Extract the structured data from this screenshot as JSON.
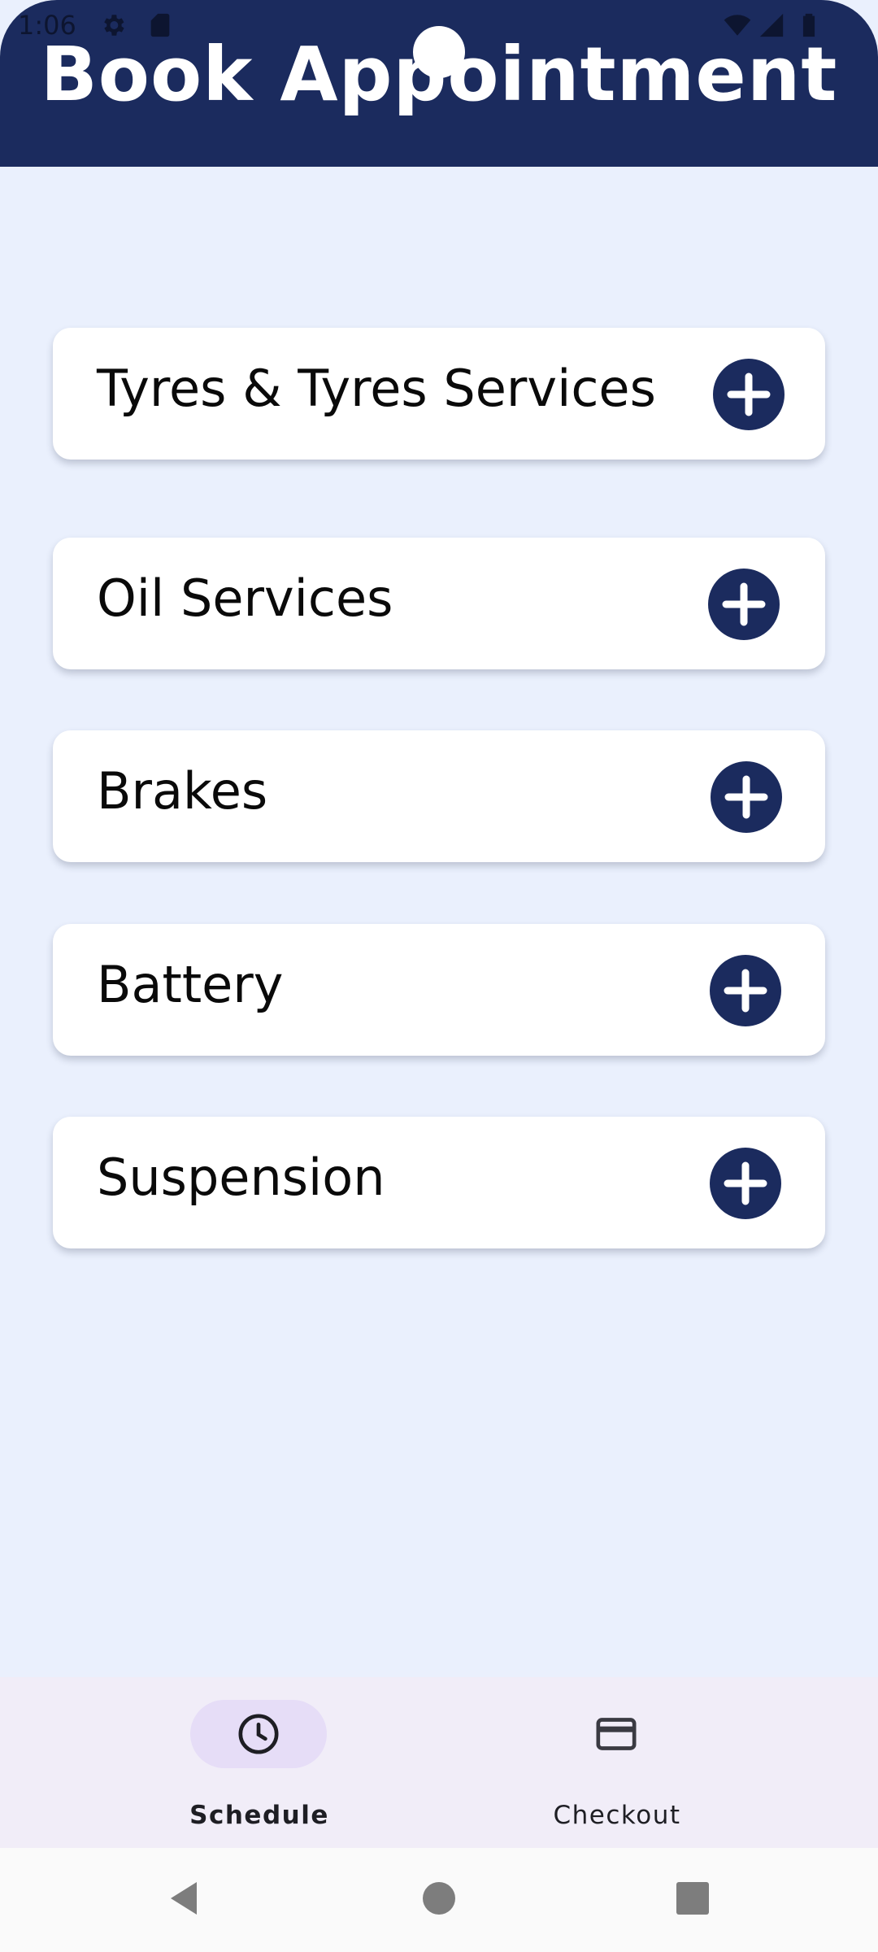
{
  "status_bar": {
    "time": "1:06",
    "icons": [
      "gear-icon",
      "sim-card-icon",
      "wifi-icon",
      "signal-icon",
      "battery-icon"
    ]
  },
  "header": {
    "title": "Book Appointment",
    "background_color": "#1b2b5e"
  },
  "services": [
    {
      "label": "Tyres & Tyres Services",
      "action_icon": "plus-icon"
    },
    {
      "label": "Oil Services",
      "action_icon": "plus-icon"
    },
    {
      "label": "Brakes",
      "action_icon": "plus-icon"
    },
    {
      "label": "Battery",
      "action_icon": "plus-icon"
    },
    {
      "label": "Suspension",
      "action_icon": "plus-icon"
    }
  ],
  "bottom_nav": {
    "items": [
      {
        "label": "Schedule",
        "icon": "clock-icon",
        "active": true
      },
      {
        "label": "Checkout",
        "icon": "credit-card-icon",
        "active": false
      }
    ]
  },
  "system_nav": {
    "buttons": [
      "back-icon",
      "home-icon",
      "recents-icon"
    ]
  },
  "colors": {
    "accent": "#1b2b5e",
    "page_background": "#eaf0fd",
    "card_background": "#ffffff",
    "nav_background": "#f1edf8",
    "nav_active_pill": "#e6ddf7"
  }
}
